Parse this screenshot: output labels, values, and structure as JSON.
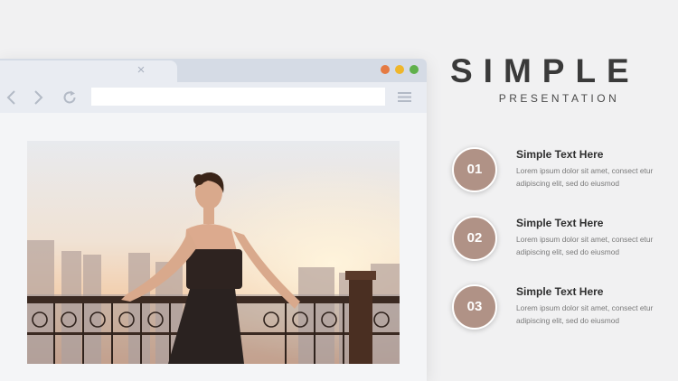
{
  "slide": {
    "title": "SIMPLE",
    "subtitle": "PRESENTATION"
  },
  "browser": {
    "tab_close_icon": "close-icon",
    "window_buttons": [
      "#e57a42",
      "#efb62a",
      "#5fb04b"
    ],
    "toolbar_icons": [
      "chevron-left-icon",
      "chevron-right-icon",
      "reload-icon",
      "hamburger-menu-icon"
    ],
    "url_value": ""
  },
  "items": [
    {
      "number": "01",
      "title": "Simple Text Here",
      "body": "Lorem ipsum dolor sit amet, consect etur adipiscing  elit, sed do eiusmod"
    },
    {
      "number": "02",
      "title": "Simple Text Here",
      "body": "Lorem ipsum dolor sit amet, consect etur adipiscing  elit, sed do eiusmod"
    },
    {
      "number": "03",
      "title": "Simple Text Here",
      "body": "Lorem ipsum dolor sit amet, consect etur adipiscing  elit, sed do eiusmod"
    }
  ],
  "colors": {
    "accent": "#b09286",
    "title_text": "#3a3a3a",
    "browser_frame": "#d5dbe5"
  }
}
